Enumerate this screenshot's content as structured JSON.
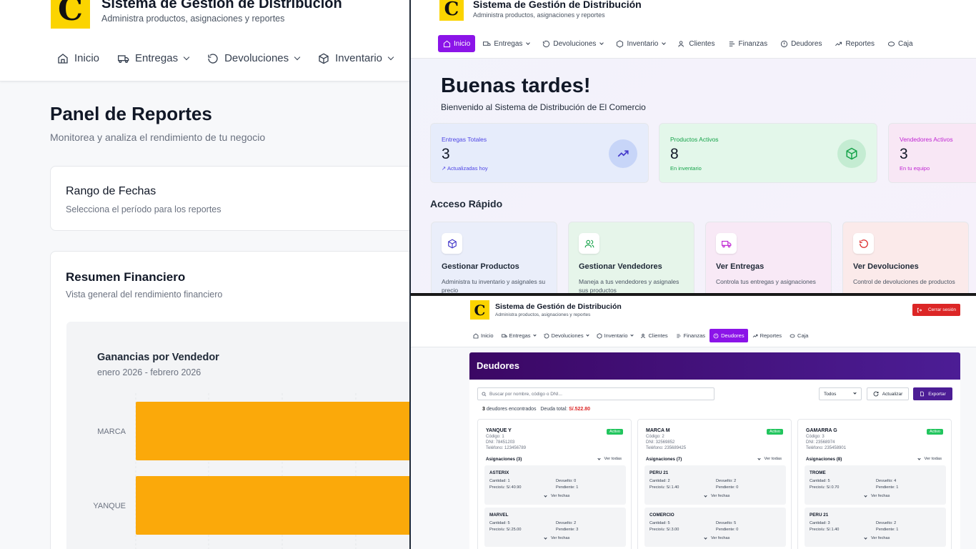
{
  "app": {
    "title": "Sistema de Gestión de Distribución",
    "subtitle": "Administra productos, asignaciones y reportes",
    "logo_letter": "C"
  },
  "colors": {
    "accent": "#8b14e8",
    "danger": "#dc2626",
    "success": "#22c55e",
    "bar": "#fba90a"
  },
  "left": {
    "nav": [
      {
        "label": "Inicio",
        "icon": "home-icon"
      },
      {
        "label": "Entregas",
        "icon": "truck-icon"
      },
      {
        "label": "Devoluciones",
        "icon": "rotate-ccw-icon"
      },
      {
        "label": "Inventario",
        "icon": "package-icon"
      }
    ],
    "page_title": "Panel de Reportes",
    "page_subtitle": "Monitorea y analiza el rendimiento de tu negocio",
    "date_card": {
      "title": "Rango de Fechas",
      "subtitle": "Selecciona el período para los reportes"
    },
    "finance_card": {
      "title": "Resumen Financiero",
      "subtitle": "Vista general del rendimiento financiero"
    }
  },
  "chart_data": {
    "type": "bar",
    "orientation": "horizontal",
    "title": "Ganancias por Vendedor",
    "subtitle": "enero 2026 - febrero 2026",
    "categories": [
      "MARCA",
      "YANQUE"
    ],
    "labels": [
      "MARCA",
      "YANQUE"
    ],
    "grid": true
  },
  "home": {
    "nav": [
      {
        "label": "Inicio",
        "icon": "home-icon"
      },
      {
        "label": "Entregas",
        "icon": "truck-icon"
      },
      {
        "label": "Devoluciones",
        "icon": "rotate-ccw-icon"
      },
      {
        "label": "Inventario",
        "icon": "package-icon"
      },
      {
        "label": "Clientes",
        "icon": "users-icon"
      },
      {
        "label": "Finanzas",
        "icon": "finance-icon"
      },
      {
        "label": "Deudores",
        "icon": "alert-circle-icon"
      },
      {
        "label": "Reportes",
        "icon": "trending-up-icon"
      },
      {
        "label": "Caja",
        "icon": "cash-icon"
      }
    ],
    "greeting": "Buenas tardes!",
    "welcome": "Bienvenido al Sistema de Distribución de El Comercio",
    "stats": [
      {
        "label": "Entregas Totales",
        "value": "3",
        "foot": "↗ Actualizadas hoy",
        "icon": "trending-up-icon"
      },
      {
        "label": "Productos Activos",
        "value": "8",
        "foot": "En inventario",
        "icon": "package-icon"
      },
      {
        "label": "Vendedores Activos",
        "value": "3",
        "foot": "En tu equipo",
        "icon": "users-icon"
      }
    ],
    "quick_title": "Acceso Rápido",
    "quick": [
      {
        "title": "Gestionar Productos",
        "desc": "Administra tu inventario y asignales su precio",
        "icon": "package-icon"
      },
      {
        "title": "Gestionar Vendedores",
        "desc": "Maneja a tus vendedores y asignales sus productos",
        "icon": "users-icon"
      },
      {
        "title": "Ver Entregas",
        "desc": "Controla tus entregas y asignaciones",
        "icon": "truck-icon"
      },
      {
        "title": "Ver Devoluciones",
        "desc": "Control de devoluciones de productos",
        "icon": "rotate-ccw-icon"
      }
    ]
  },
  "debtors": {
    "logout": "Cerrar sesión",
    "title": "Deudores",
    "search_placeholder": "Buscar por nombre, código o DNI...",
    "filter": "Todos",
    "refresh": "Actualizar",
    "export": "Exportar",
    "count": "3",
    "count_label": "deudores encontrados",
    "total_label": "Deuda total:",
    "total": "S/.522.80",
    "cards": [
      {
        "name": "YANQUE Y",
        "code": "Código: 1",
        "dni": "DNI: 78451203",
        "phone": "Teléfono: 123456789",
        "status": "Activo",
        "asg": "Asignaciones (3)",
        "items": [
          {
            "name": "ASTERIX",
            "cant": "Cantidad: 1",
            "dev": "Devuelto: 0",
            "precio": "Precio/u: S/.40.90",
            "pend": "Pendiente: 1"
          },
          {
            "name": "MARVEL",
            "cant": "Cantidad: 5",
            "dev": "Devuelto: 2",
            "precio": "Precio/u: S/.25.00",
            "pend": "Pendiente: 3"
          }
        ]
      },
      {
        "name": "MARCA M",
        "code": "Código: 2",
        "dni": "DNI: 32569852",
        "phone": "Teléfono: 235689425",
        "status": "Activo",
        "asg": "Asignaciones (7)",
        "items": [
          {
            "name": "PERU 21",
            "cant": "Cantidad: 2",
            "dev": "Devuelto: 2",
            "precio": "Precio/u: S/.1.40",
            "pend": "Pendiente: 0"
          },
          {
            "name": "COMERCIO",
            "cant": "Cantidad: 5",
            "dev": "Devuelto: 5",
            "precio": "Precio/u: S/.3.00",
            "pend": "Pendiente: 0"
          }
        ]
      },
      {
        "name": "GAMARRA G",
        "code": "Código: 3",
        "dni": "DNI: 23568974",
        "phone": "Teléfono: 235458901",
        "status": "Activo",
        "asg": "Asignaciones (8)",
        "items": [
          {
            "name": "TROME",
            "cant": "Cantidad: 5",
            "dev": "Devuelto: 4",
            "precio": "Precio/u: S/.0.70",
            "pend": "Pendiente: 1"
          },
          {
            "name": "PERU 21",
            "cant": "Cantidad: 3",
            "dev": "Devuelto: 2",
            "precio": "Precio/u: S/.1.40",
            "pend": "Pendiente: 1"
          }
        ]
      }
    ],
    "view_all": "Ver todas",
    "view_dates": "Ver fechas",
    "nav": [
      {
        "label": "Inicio",
        "icon": "home-icon"
      },
      {
        "label": "Entregas",
        "icon": "truck-icon"
      },
      {
        "label": "Devoluciones",
        "icon": "rotate-ccw-icon"
      },
      {
        "label": "Inventario",
        "icon": "package-icon"
      },
      {
        "label": "Clientes",
        "icon": "users-icon"
      },
      {
        "label": "Finanzas",
        "icon": "finance-icon"
      },
      {
        "label": "Deudores",
        "icon": "alert-circle-icon"
      },
      {
        "label": "Reportes",
        "icon": "trending-up-icon"
      },
      {
        "label": "Caja",
        "icon": "cash-icon"
      }
    ]
  }
}
